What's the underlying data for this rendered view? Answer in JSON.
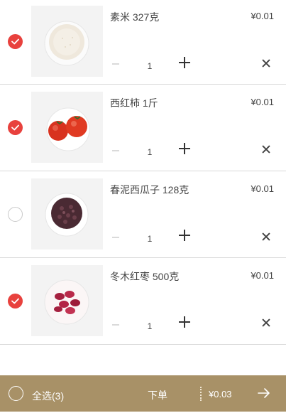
{
  "items": [
    {
      "name": "素米 327克",
      "price": "¥0.01",
      "qty": "1",
      "checked": true,
      "image": "rice-bowl"
    },
    {
      "name": "西红柿 1斤",
      "price": "¥0.01",
      "qty": "1",
      "checked": true,
      "image": "tomatoes"
    },
    {
      "name": "春泥西瓜子 128克",
      "price": "¥0.01",
      "qty": "1",
      "checked": false,
      "image": "seeds-bowl"
    },
    {
      "name": "冬木红枣 500克",
      "price": "¥0.01",
      "qty": "1",
      "checked": true,
      "image": "red-dates-bowl"
    }
  ],
  "footer": {
    "select_all_label": "全选(3)",
    "order_label": "下单",
    "total": "¥0.03"
  },
  "colors": {
    "accent": "#e8413d",
    "footer_bg": "#a89167"
  },
  "icons": [
    "check-icon",
    "minus-icon",
    "plus-icon",
    "close-icon",
    "arrow-right-icon"
  ]
}
